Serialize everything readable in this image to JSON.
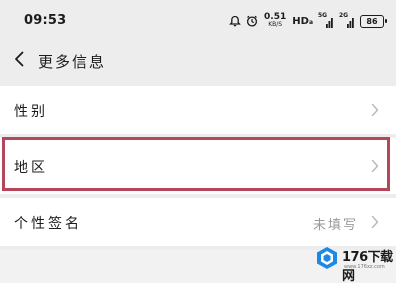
{
  "status_bar": {
    "time": "09:53",
    "speed_value": "0.51",
    "speed_unit": "KB/S",
    "hd_label": "HD",
    "net_label": "5G",
    "net_label_2": "2G",
    "battery_level": "86",
    "icons": [
      "alarm-icon",
      "clock-icon",
      "signal-icon",
      "battery-icon"
    ]
  },
  "nav": {
    "title": "更多信息",
    "back_icon": "chevron-left-icon"
  },
  "rows": [
    {
      "label": "性别",
      "value": "",
      "icon": "chevron-right-icon"
    },
    {
      "label": "地区",
      "value": "",
      "icon": "chevron-right-icon",
      "highlighted": true
    },
    {
      "label": "个性签名",
      "value": "未填写",
      "icon": "chevron-right-icon"
    }
  ],
  "watermark": {
    "text": "176下载网",
    "sub": "www.176xz.com"
  },
  "colors": {
    "background": "#ededed",
    "row_background": "#ffffff",
    "highlight_border": "#b5475c",
    "secondary_text": "#9a9a9a",
    "watermark_logo": "#1e88e5"
  }
}
